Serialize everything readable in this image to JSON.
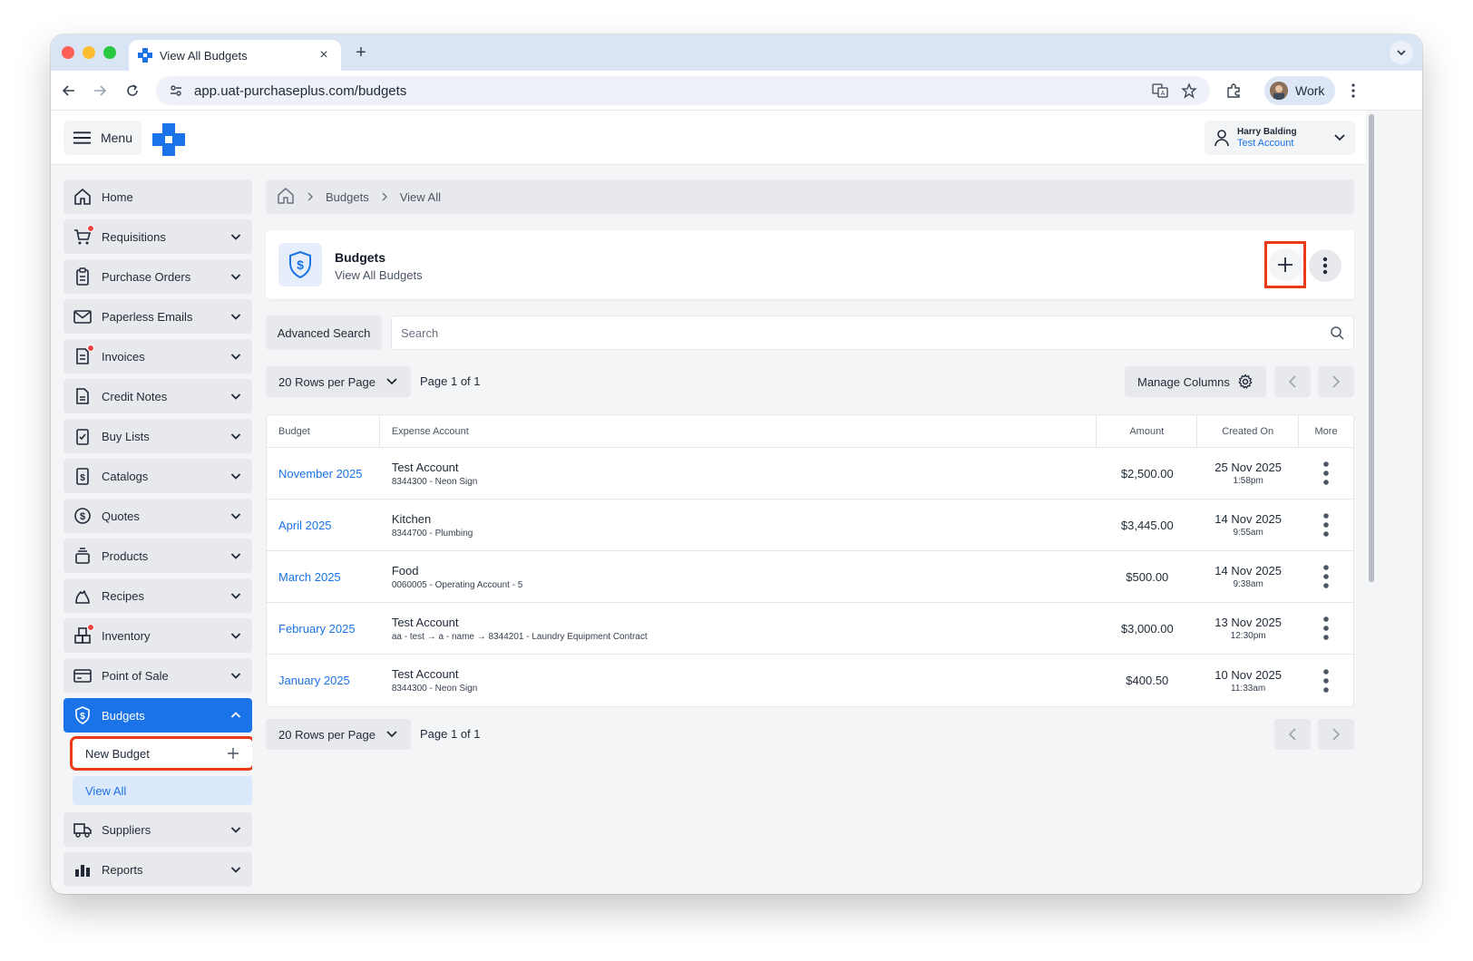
{
  "browser": {
    "tab_title": "View All Budgets",
    "url": "app.uat-purchaseplus.com/budgets",
    "profile_label": "Work"
  },
  "header": {
    "menu_label": "Menu",
    "user_name": "Harry Balding",
    "user_account": "Test Account"
  },
  "sidebar": {
    "items": [
      {
        "label": "Home",
        "icon": "home-icon"
      },
      {
        "label": "Requisitions",
        "icon": "cart-icon",
        "badge": true
      },
      {
        "label": "Purchase Orders",
        "icon": "clipboard-icon"
      },
      {
        "label": "Paperless Emails",
        "icon": "mail-icon"
      },
      {
        "label": "Invoices",
        "icon": "invoice-icon",
        "badge": true
      },
      {
        "label": "Credit Notes",
        "icon": "document-icon"
      },
      {
        "label": "Buy Lists",
        "icon": "checklist-icon"
      },
      {
        "label": "Catalogs",
        "icon": "catalog-icon"
      },
      {
        "label": "Quotes",
        "icon": "dollar-circle-icon"
      },
      {
        "label": "Products",
        "icon": "products-icon"
      },
      {
        "label": "Recipes",
        "icon": "flame-icon"
      },
      {
        "label": "Inventory",
        "icon": "inventory-icon",
        "badge": true
      },
      {
        "label": "Point of Sale",
        "icon": "card-icon"
      },
      {
        "label": "Budgets",
        "icon": "shield-dollar-icon",
        "active": true
      },
      {
        "label": "Suppliers",
        "icon": "truck-icon"
      },
      {
        "label": "Reports",
        "icon": "chart-icon"
      }
    ],
    "budgets_sub": {
      "new_budget": "New Budget",
      "view_all": "View All"
    }
  },
  "breadcrumb": {
    "level1": "Budgets",
    "level2": "View All"
  },
  "panel": {
    "title": "Budgets",
    "subtitle": "View All Budgets"
  },
  "search": {
    "advanced_label": "Advanced Search",
    "placeholder": "Search"
  },
  "pagination": {
    "rows_label": "20 Rows per Page",
    "page_info": "Page 1 of 1",
    "manage_columns": "Manage Columns"
  },
  "table": {
    "headers": {
      "budget": "Budget",
      "expense_account": "Expense Account",
      "amount": "Amount",
      "created_on": "Created On",
      "more": "More"
    },
    "rows": [
      {
        "budget": "November 2025",
        "account": "Test Account",
        "code": "8344300 - Neon Sign",
        "amount": "$2,500.00",
        "date": "25 Nov 2025",
        "time": "1:58pm"
      },
      {
        "budget": "April 2025",
        "account": "Kitchen",
        "code": "8344700 - Plumbing",
        "amount": "$3,445.00",
        "date": "14 Nov 2025",
        "time": "9:55am"
      },
      {
        "budget": "March 2025",
        "account": "Food",
        "code": "0060005 - Operating Account - 5",
        "amount": "$500.00",
        "date": "14 Nov 2025",
        "time": "9:38am"
      },
      {
        "budget": "February 2025",
        "account": "Test Account",
        "code": "aa - test → a - name → 8344201 - Laundry Equipment Contract",
        "amount": "$3,000.00",
        "date": "13 Nov 2025",
        "time": "12:30pm"
      },
      {
        "budget": "January 2025",
        "account": "Test Account",
        "code": "8344300 - Neon Sign",
        "amount": "$400.50",
        "date": "10 Nov 2025",
        "time": "11:33am"
      }
    ]
  },
  "colors": {
    "accent": "#1a73e8",
    "highlight": "#ea3a16",
    "badge": "#ef4444"
  }
}
